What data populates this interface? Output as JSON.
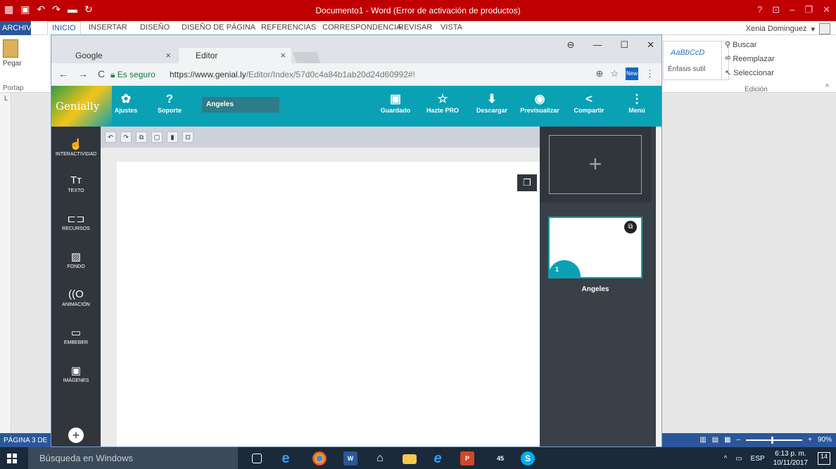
{
  "word": {
    "title": "Documento1 - Word (Error de activación de productos)",
    "tabs": [
      "ARCHIVO",
      "INICIO",
      "INSERTAR",
      "DISEÑO",
      "DISEÑO DE PÁGINA",
      "REFERENCIAS",
      "CORRESPONDENCIA",
      "REVISAR",
      "VISTA"
    ],
    "user": "Xenia Dominguez",
    "paste_label": "Pegar",
    "clipboard_group": "Portap",
    "style_sample": "AaBbCcD",
    "style_name": "Énfasis sutil",
    "edit_find": "Buscar",
    "edit_replace": "Reemplazar",
    "edit_select": "Seleccionar",
    "edit_group": "Edición",
    "status_page": "PÁGINA 3 DE",
    "zoom": "90%"
  },
  "taskbar": {
    "search_placeholder": "Búsqueda en Windows",
    "lang": "ESP",
    "time": "6:13 p. m.",
    "date": "10/11/2017",
    "notifications": "14",
    "mail_badge": "45"
  },
  "chrome": {
    "tabs": [
      {
        "label": "Google"
      },
      {
        "label": "Editor"
      }
    ],
    "secure_label": "Es seguro",
    "url_host": "https://www.genial.ly",
    "url_path": "/Editor/Index/57d0c4a84b1ab20d24d60992#!",
    "ext_label": "New"
  },
  "genially": {
    "logo": "Genially",
    "buttons": {
      "settings": "Ajustes",
      "support": "Soporte",
      "saved": "Guardado",
      "pro": "Hazte PRO",
      "download": "Descargar",
      "preview": "Previsualizar",
      "share": "Compartir",
      "menu": "Menú"
    },
    "project_name": "Angeles",
    "sidebar": [
      "INTERACTIVIDAD",
      "TEXTO",
      "RECURSOS",
      "FONDO",
      "ANIMACIÓN",
      "EMBEBER",
      "IMÁGENES"
    ],
    "slide_number": "1",
    "slide_name": "Angeles"
  },
  "colors": {
    "word_red": "#c00000",
    "word_blue": "#2b579a",
    "genially_teal": "#0aa1b5",
    "panel_dark": "#3a4047"
  }
}
